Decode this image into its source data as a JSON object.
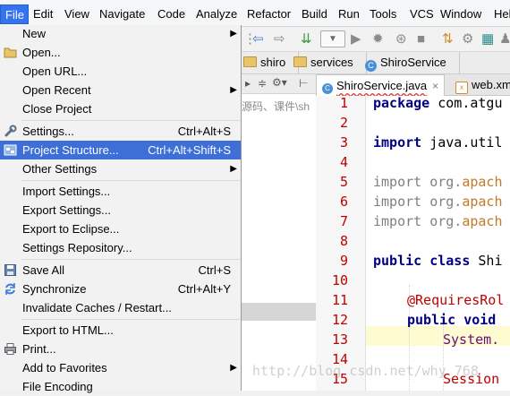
{
  "menubar": {
    "items": [
      "File",
      "Edit",
      "View",
      "Navigate",
      "Code",
      "Analyze",
      "Refactor",
      "Build",
      "Run",
      "Tools",
      "VCS",
      "Window",
      "Help"
    ]
  },
  "file_menu": {
    "items": [
      {
        "label": "New",
        "submenu": true
      },
      {
        "label": "Open...",
        "icon": "folder-open-icon"
      },
      {
        "label": "Open URL..."
      },
      {
        "label": "Open Recent",
        "submenu": true
      },
      {
        "label": "Close Project"
      },
      {
        "label": "Settings...",
        "shortcut": "Ctrl+Alt+S",
        "icon": "wrench-icon"
      },
      {
        "label": "Project Structure...",
        "shortcut": "Ctrl+Alt+Shift+S",
        "icon": "project-structure-icon",
        "selected": true
      },
      {
        "label": "Other Settings",
        "submenu": true
      },
      {
        "label": "Import Settings..."
      },
      {
        "label": "Export Settings..."
      },
      {
        "label": "Export to Eclipse..."
      },
      {
        "label": "Settings Repository..."
      },
      {
        "label": "Save All",
        "shortcut": "Ctrl+S",
        "icon": "save-icon"
      },
      {
        "label": "Synchronize",
        "shortcut": "Ctrl+Alt+Y",
        "icon": "sync-icon"
      },
      {
        "label": "Invalidate Caches / Restart..."
      },
      {
        "label": "Export to HTML..."
      },
      {
        "label": "Print...",
        "icon": "print-icon"
      },
      {
        "label": "Add to Favorites",
        "submenu": true
      },
      {
        "label": "File Encoding"
      }
    ]
  },
  "breadcrumb": {
    "items": [
      "shiro",
      "services",
      "ShiroService"
    ]
  },
  "project_panel": {
    "tree_text": "源码、课件\\sh"
  },
  "editor": {
    "tabs": [
      {
        "label": "ShiroService.java",
        "active": true,
        "close": "×"
      },
      {
        "label": "web.xm"
      }
    ],
    "line_numbers": [
      "1",
      "2",
      "3",
      "4",
      "5",
      "6",
      "7",
      "8",
      "9",
      "10",
      "11",
      "12",
      "13",
      "14",
      "15"
    ],
    "code": {
      "l1_kw": "package",
      "l1_rest": " com.atgu",
      "l3_kw": "import",
      "l3_rest": " java.util",
      "l5_kw": "import",
      "l5_pre": " org.",
      "l5_pkg": "apach",
      "l6_kw": "import",
      "l6_pre": " org.",
      "l6_pkg": "apach",
      "l7_kw": "import",
      "l7_pre": " org.",
      "l7_pkg": "apach",
      "l9_kw": "public class",
      "l9_rest": " Shi",
      "l11_ann": "@RequiresRol",
      "l12_kw": "public void",
      "l13_fld": "System.",
      "l15_ann": "Session"
    }
  },
  "watermark": "http://blog.csdn.net/why_768"
}
